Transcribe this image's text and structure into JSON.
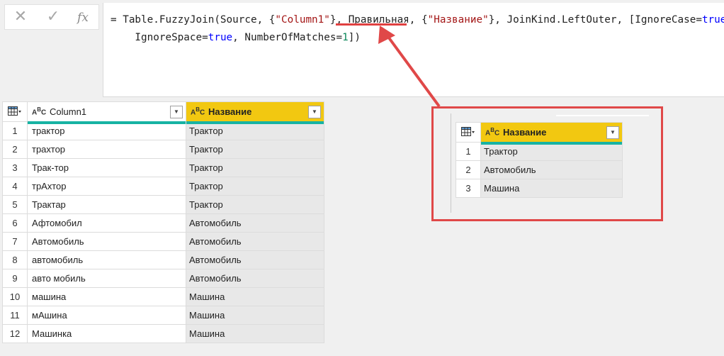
{
  "formula_bar": {
    "cancel_icon": "close-icon",
    "confirm_icon": "check-icon",
    "fx_label": "fx",
    "line1": {
      "p1": "= Table.FuzzyJoin(Source, {",
      "s1": "\"Column1\"",
      "p2": "}, ",
      "p3": "Правильная",
      "p4": ", {",
      "s2": "\"Название\"",
      "p5": "}, JoinKind.LeftOuter, [IgnoreCase=",
      "k1": "true",
      "p6": ","
    },
    "line2": {
      "p1": "    IgnoreSpace=",
      "k1": "true",
      "p2": ", NumberOfMatches=",
      "n1": "1",
      "p3": "])"
    }
  },
  "main_table": {
    "columns": [
      {
        "type_icon": "ABC",
        "label": "Column1"
      },
      {
        "type_icon": "ABC",
        "label": "Название"
      }
    ],
    "rows": [
      {
        "n": "1",
        "c1": "трактор",
        "c2": "Трактор"
      },
      {
        "n": "2",
        "c1": "трахтор",
        "c2": "Трактор"
      },
      {
        "n": "3",
        "c1": "Трак-тор",
        "c2": "Трактор"
      },
      {
        "n": "4",
        "c1": "трАхтор",
        "c2": "Трактор"
      },
      {
        "n": "5",
        "c1": "Трактар",
        "c2": "Трактор"
      },
      {
        "n": "6",
        "c1": "Афтомобил",
        "c2": "Автомобиль"
      },
      {
        "n": "7",
        "c1": "Автомобиль",
        "c2": "Автомобиль"
      },
      {
        "n": "8",
        "c1": "автомобиль",
        "c2": "Автомобиль"
      },
      {
        "n": "9",
        "c1": "авто мобиль",
        "c2": "Автомобиль"
      },
      {
        "n": "10",
        "c1": "машина",
        "c2": "Машина"
      },
      {
        "n": "11",
        "c1": "мАшина",
        "c2": "Машина"
      },
      {
        "n": "12",
        "c1": "Машинка",
        "c2": "Машина"
      }
    ]
  },
  "ref_table": {
    "column": {
      "type_icon": "ABC",
      "label": "Название"
    },
    "rows": [
      {
        "n": "1",
        "c": "Трактор"
      },
      {
        "n": "2",
        "c": "Автомобиль"
      },
      {
        "n": "3",
        "c": "Машина"
      }
    ]
  },
  "colors": {
    "header_highlight": "#f2c811",
    "quality_bar": "#17b3a3",
    "annotation": "#e04040"
  }
}
